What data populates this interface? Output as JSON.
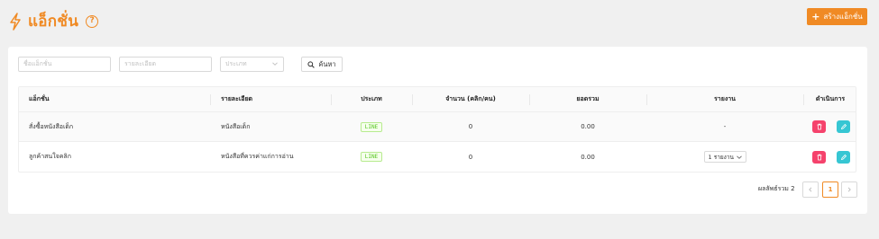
{
  "header": {
    "title": "แอ็กชั่น",
    "help_symbol": "?",
    "create_label": "สร้างแอ็กชั่น",
    "create_symbol": "+"
  },
  "filters": {
    "name_placeholder": "ชื่อแอ็กชั่น",
    "detail_placeholder": "รายละเอียด",
    "type_placeholder": "ประเภท",
    "search_label": "ค้นหา"
  },
  "table": {
    "columns": [
      "แอ็กชั่น",
      "รายละเอียด",
      "ประเภท",
      "จำนวน (คลิก/คน)",
      "ยอดรวม",
      "รายงาน",
      "ดำเนินการ"
    ],
    "rows": [
      {
        "action": "สั่งซื้อหนังสือเด็ก",
        "detail": "หนังสือเด็ก",
        "type": "LINE",
        "count": "0",
        "total": "0.00",
        "report": "-"
      },
      {
        "action": "ลูกค้าสนใจคลิก",
        "detail": "หนังสือที่ควรค่าแก่การอ่าน",
        "type": "LINE",
        "count": "0",
        "total": "0.00",
        "report": "1 รายงาน"
      }
    ]
  },
  "pagination": {
    "total_text": "ผลลัพธ์รวม 2",
    "current_page": "1"
  },
  "colors": {
    "accent": "#f08a24",
    "delete": "#f5426c",
    "edit": "#36c6d3",
    "line_tag": "#52c41a"
  }
}
